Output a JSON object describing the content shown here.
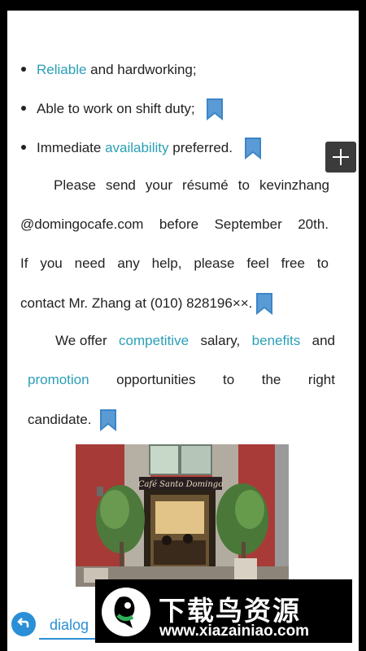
{
  "bullets": [
    {
      "highlight": "Reliable",
      "rest": " and hardworking;",
      "prefix": ""
    },
    {
      "prefix": "Able to work on shift duty;",
      "highlight": "",
      "rest": ""
    },
    {
      "prefix": "Immediate ",
      "highlight": "availability",
      "rest": " preferred."
    }
  ],
  "paragraph1": {
    "line1": "Please send your résumé to kevinzhang",
    "line2": "@domingocafe.com before September 20th.",
    "line3": "If you need any help, please feel free to",
    "line4": "contact Mr. Zhang at (010) 828196××."
  },
  "paragraph2": {
    "we_offer": "We offer",
    "competitive": "competitive",
    "salary": "salary,",
    "benefits": "benefits",
    "and": "and",
    "promotion": "promotion",
    "line2_rest": [
      "opportunities",
      "to",
      "the",
      "right"
    ],
    "candidate": "candidate."
  },
  "photo": {
    "sign_text": "Café Santo Domingo"
  },
  "bottom_bar": {
    "dialog_label": "dialog"
  },
  "watermark": {
    "title": "下载鸟资源",
    "url": "www.xiazainiao.com"
  },
  "colors": {
    "highlight": "#2a9fb6",
    "bookmark": "#3d85c6",
    "accent": "#2a8fd6"
  }
}
